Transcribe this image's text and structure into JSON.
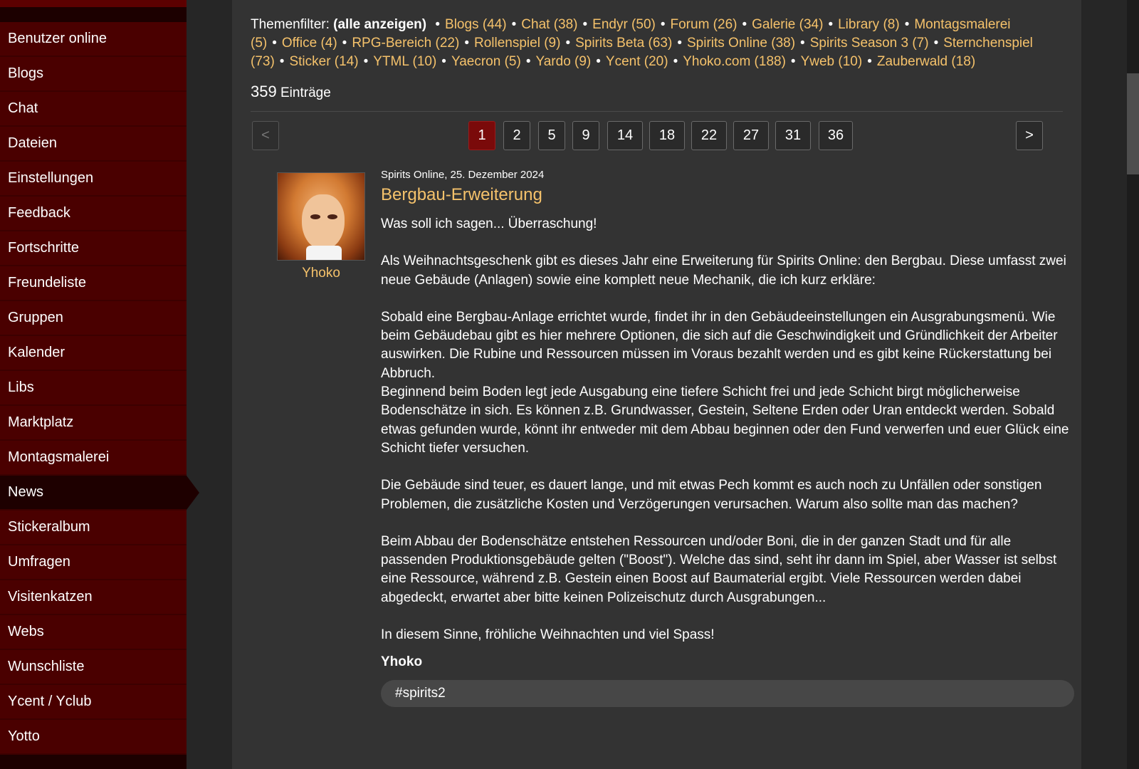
{
  "sidebar": {
    "items": [
      {
        "label": "Benutzer online"
      },
      {
        "label": "Blogs"
      },
      {
        "label": "Chat"
      },
      {
        "label": "Dateien"
      },
      {
        "label": "Einstellungen"
      },
      {
        "label": "Feedback"
      },
      {
        "label": "Fortschritte"
      },
      {
        "label": "Freundeliste"
      },
      {
        "label": "Gruppen"
      },
      {
        "label": "Kalender"
      },
      {
        "label": "Libs"
      },
      {
        "label": "Marktplatz"
      },
      {
        "label": "Montagsmalerei"
      },
      {
        "label": "News",
        "active": true
      },
      {
        "label": "Stickeralbum"
      },
      {
        "label": "Umfragen"
      },
      {
        "label": "Visitenkatzen"
      },
      {
        "label": "Webs"
      },
      {
        "label": "Wunschliste"
      },
      {
        "label": "Ycent / Yclub"
      },
      {
        "label": "Yotto"
      }
    ]
  },
  "filter": {
    "label": "Themenfilter:",
    "show_all": "(alle anzeigen)",
    "topics": [
      "Blogs (44)",
      "Chat (38)",
      "Endyr (50)",
      "Forum (26)",
      "Galerie (34)",
      "Library (8)",
      "Montagsmalerei (5)",
      "Office (4)",
      "RPG-Bereich (22)",
      "Rollenspiel (9)",
      "Spirits Beta (63)",
      "Spirits Online (38)",
      "Spirits Season 3 (7)",
      "Sternchenspiel (73)",
      "Sticker (14)",
      "YTML (10)",
      "Yaecron (5)",
      "Yardo (9)",
      "Ycent (20)",
      "Yhoko.com (188)",
      "Yweb (10)",
      "Zauberwald (18)"
    ],
    "separator": "•"
  },
  "entries": {
    "count": "359",
    "label": "Einträge"
  },
  "pagination": {
    "prev": "<",
    "next": ">",
    "pages": [
      "1",
      "2",
      "5",
      "9",
      "14",
      "18",
      "22",
      "27",
      "31",
      "36"
    ],
    "current": "1"
  },
  "post": {
    "author": "Yhoko",
    "meta": "Spirits Online, 25. Dezember 2024",
    "title": "Bergbau-Erweiterung",
    "p1": "Was soll ich sagen... Überraschung!",
    "p2": "Als Weihnachtsgeschenk gibt es dieses Jahr eine Erweiterung für Spirits Online: den Bergbau. Diese umfasst zwei neue Gebäude (Anlagen) sowie eine komplett neue Mechanik, die ich kurz erkläre:",
    "p3": "Sobald eine Bergbau-Anlage errichtet wurde, findet ihr in den Gebäudeeinstellungen ein Ausgrabungsmenü. Wie beim Gebäudebau gibt es hier mehrere Optionen, die sich auf die Geschwindigkeit und Gründlichkeit der Arbeiter auswirken. Die Rubine und Ressourcen müssen im Voraus bezahlt werden und es gibt keine Rückerstattung bei Abbruch.",
    "p4": "Beginnend beim Boden legt jede Ausgabung eine tiefere Schicht frei und jede Schicht birgt möglicherweise Bodenschätze in sich. Es können z.B. Grundwasser, Gestein, Seltene Erden oder Uran entdeckt werden. Sobald etwas gefunden wurde, könnt ihr entweder mit dem Abbau beginnen oder den Fund verwerfen und euer Glück eine Schicht tiefer versuchen.",
    "p5": "Die Gebäude sind teuer, es dauert lange, und mit etwas Pech kommt es auch noch zu Unfällen oder sonstigen Problemen, die zusätzliche Kosten und Verzögerungen verursachen. Warum also sollte man das machen?",
    "p6": "Beim Abbau der Bodenschätze entstehen Ressourcen und/oder Boni, die in der ganzen Stadt und für alle passenden Produktionsgebäude gelten (\"Boost\"). Welche das sind, seht ihr dann im Spiel, aber Wasser ist selbst eine Ressource, während z.B. Gestein einen Boost auf Baumaterial ergibt. Viele Ressourcen werden dabei abgedeckt, erwartet aber bitte keinen Polizeischutz durch Ausgrabungen...",
    "p7": "In diesem Sinne, fröhliche Weihnachten und viel Spass!",
    "signature": "Yhoko",
    "tag": "#spirits2"
  },
  "colors": {
    "link": "#f5c26b",
    "sidebar_bg": "#4a0000",
    "sidebar_active": "#1e0000",
    "content_bg": "#333333",
    "page_current": "#7a0a0a"
  }
}
